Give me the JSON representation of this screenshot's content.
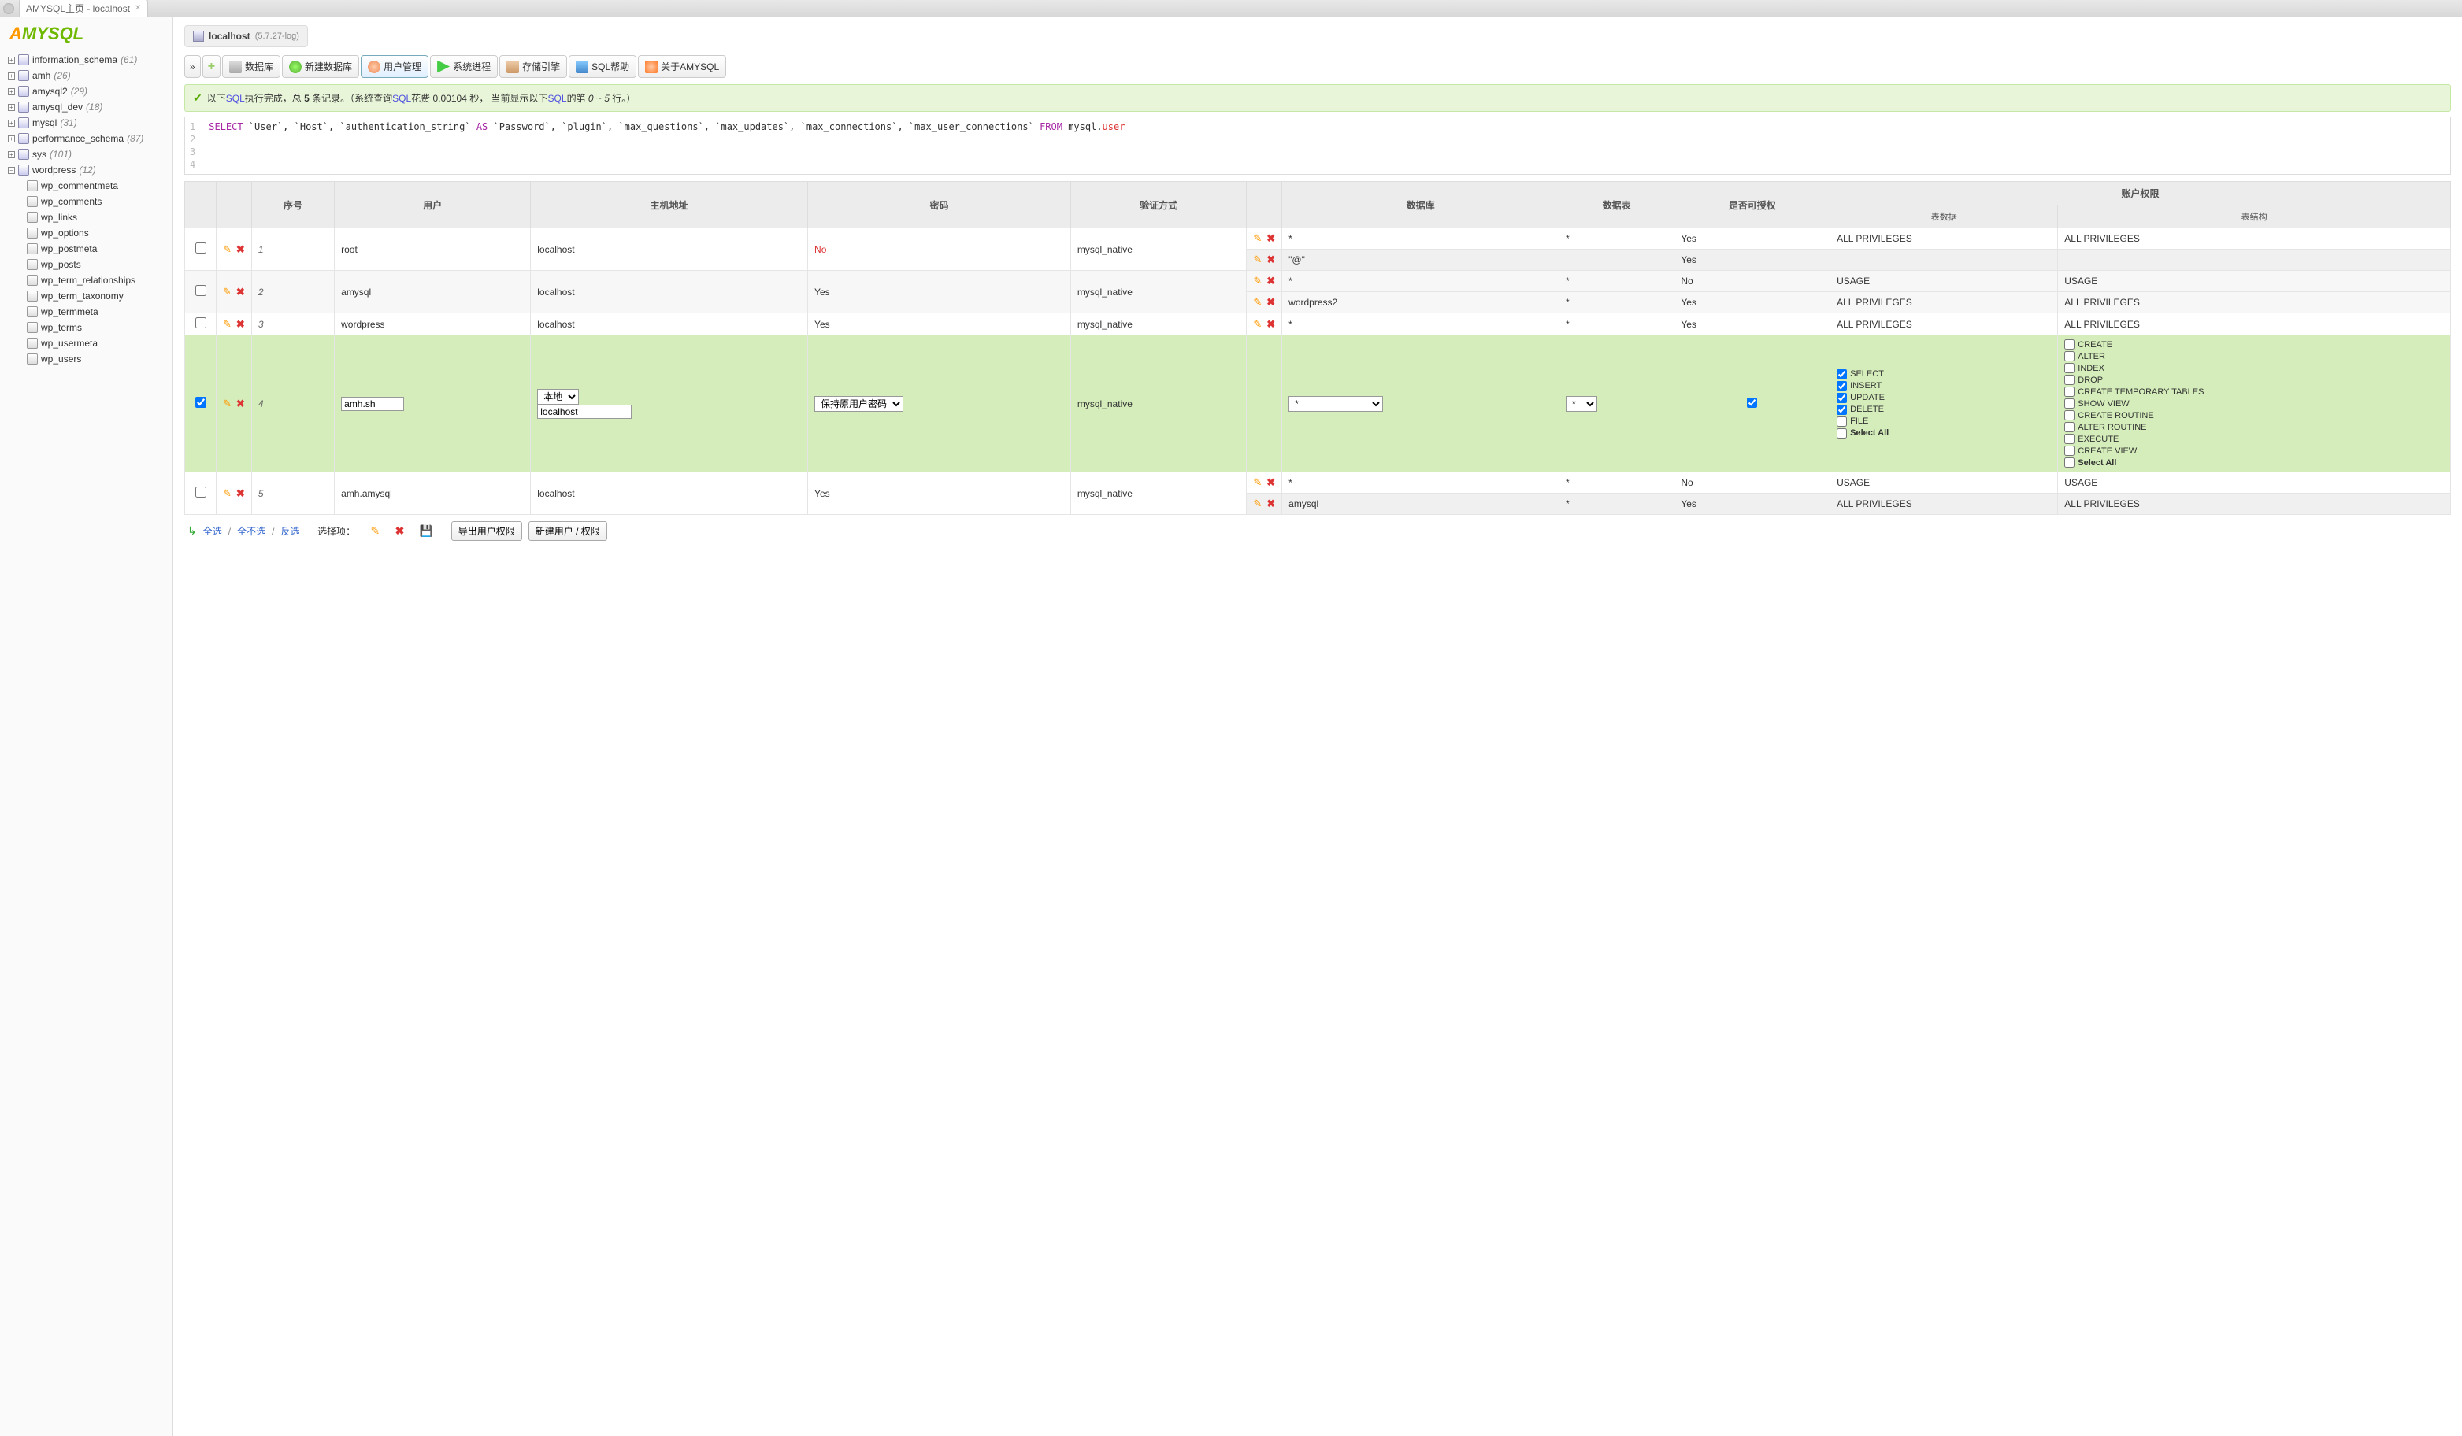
{
  "app": {
    "tab_title": "AMYSQL主页 - localhost"
  },
  "logo": {
    "part1": "A",
    "part2": "MY",
    "part3": "SQL"
  },
  "sidebar": {
    "items": [
      {
        "label": "information_schema",
        "count": "(61)",
        "toggle": "+"
      },
      {
        "label": "amh",
        "count": "(26)",
        "toggle": "+"
      },
      {
        "label": "amysql2",
        "count": "(29)",
        "toggle": "+"
      },
      {
        "label": "amysql_dev",
        "count": "(18)",
        "toggle": "+"
      },
      {
        "label": "mysql",
        "count": "(31)",
        "toggle": "+"
      },
      {
        "label": "performance_schema",
        "count": "(87)",
        "toggle": "+"
      },
      {
        "label": "sys",
        "count": "(101)",
        "toggle": "+"
      },
      {
        "label": "wordpress",
        "count": "(12)",
        "toggle": "−"
      }
    ],
    "tables": [
      "wp_commentmeta",
      "wp_comments",
      "wp_links",
      "wp_options",
      "wp_postmeta",
      "wp_posts",
      "wp_term_relationships",
      "wp_term_taxonomy",
      "wp_termmeta",
      "wp_terms",
      "wp_usermeta",
      "wp_users"
    ]
  },
  "breadcrumb": {
    "host": "localhost",
    "version": "(5.7.27-log)"
  },
  "toolbar": {
    "nav": "»",
    "items": [
      {
        "label": "数据库"
      },
      {
        "label": "新建数据库"
      },
      {
        "label": "用户管理"
      },
      {
        "label": "系统进程"
      },
      {
        "label": "存储引擎"
      },
      {
        "label": "SQL帮助"
      },
      {
        "label": "关于AMYSQL"
      }
    ]
  },
  "status": {
    "prefix": "以下",
    "sql1": "SQL",
    "mid1": "执行完成，总 ",
    "count": "5",
    "mid2": " 条记录。（系统查询",
    "sql2": "SQL",
    "mid3": "花费 0.00104 秒，  当前显示以下",
    "sql3": "SQL",
    "mid4": "的第 ",
    "range": "0 ~ 5",
    "mid5": " 行。）"
  },
  "sql_display": {
    "line1_parts": {
      "p1": "SELECT",
      "p2": " `User`, `Host`, `authentication_string` ",
      "p3": "AS",
      "p4": " `Password`, `plugin`, `max_questions`, `max_updates`, `max_connections`, `max_user_connections` ",
      "p5": "FROM",
      "p6": " mysql.",
      "p7": "user"
    },
    "gutter": [
      "1",
      "2",
      "3",
      "4"
    ]
  },
  "table": {
    "headers": {
      "seq": "序号",
      "user": "用户",
      "host": "主机地址",
      "password": "密码",
      "auth": "验证方式",
      "db": "数据库",
      "tables": "数据表",
      "grant": "是否可授权",
      "priv": "账户权限",
      "priv_data": "表数据",
      "priv_struct": "表结构"
    },
    "rows": [
      {
        "seq": "1",
        "user": "root",
        "host": "localhost",
        "pw": "No",
        "pw_class": "no-text",
        "auth": "mysql_native",
        "subs": [
          {
            "db": "*",
            "tbl": "*",
            "grant": "Yes",
            "pd": "ALL PRIVILEGES",
            "ps": "ALL PRIVILEGES"
          },
          {
            "db": "\"@\"",
            "tbl": "",
            "grant": "Yes",
            "pd": "",
            "ps": ""
          }
        ]
      },
      {
        "seq": "2",
        "user": "amysql",
        "host": "localhost",
        "pw": "Yes",
        "auth": "mysql_native",
        "subs": [
          {
            "db": "*",
            "tbl": "*",
            "grant": "No",
            "pd": "USAGE",
            "ps": "USAGE"
          },
          {
            "db": "wordpress2",
            "tbl": "*",
            "grant": "Yes",
            "pd": "ALL PRIVILEGES",
            "ps": "ALL PRIVILEGES"
          }
        ]
      },
      {
        "seq": "3",
        "user": "wordpress",
        "host": "localhost",
        "pw": "Yes",
        "auth": "mysql_native",
        "subs": [
          {
            "db": "*",
            "tbl": "*",
            "grant": "Yes",
            "pd": "ALL PRIVILEGES",
            "ps": "ALL PRIVILEGES"
          }
        ]
      },
      {
        "seq": "5",
        "user": "amh.amysql",
        "host": "localhost",
        "pw": "Yes",
        "auth": "mysql_native",
        "subs": [
          {
            "db": "*",
            "tbl": "*",
            "grant": "No",
            "pd": "USAGE",
            "ps": "USAGE"
          },
          {
            "db": "amysql",
            "tbl": "*",
            "grant": "Yes",
            "pd": "ALL PRIVILEGES",
            "ps": "ALL PRIVILEGES"
          }
        ]
      }
    ],
    "edit_row": {
      "seq": "4",
      "user_value": "amh.sh",
      "host_type": "本地",
      "host_value": "localhost",
      "pw_option": "保持原用户密码",
      "auth": "mysql_native",
      "db": "*",
      "tbl": "*",
      "priv_data": [
        {
          "label": "SELECT",
          "checked": true
        },
        {
          "label": "INSERT",
          "checked": true
        },
        {
          "label": "UPDATE",
          "checked": true
        },
        {
          "label": "DELETE",
          "checked": true
        },
        {
          "label": "FILE",
          "checked": false
        },
        {
          "label": "Select All",
          "checked": false,
          "bold": true
        }
      ],
      "priv_struct": [
        {
          "label": "CREATE",
          "checked": false
        },
        {
          "label": "ALTER",
          "checked": false
        },
        {
          "label": "INDEX",
          "checked": false
        },
        {
          "label": "DROP",
          "checked": false
        },
        {
          "label": "CREATE TEMPORARY TABLES",
          "checked": false
        },
        {
          "label": "SHOW VIEW",
          "checked": false
        },
        {
          "label": "CREATE ROUTINE",
          "checked": false
        },
        {
          "label": "ALTER ROUTINE",
          "checked": false
        },
        {
          "label": "EXECUTE",
          "checked": false
        },
        {
          "label": "CREATE VIEW",
          "checked": false
        },
        {
          "label": "Select All",
          "checked": false,
          "bold": true
        }
      ]
    }
  },
  "footer": {
    "select_all": "全选",
    "select_none": "全不选",
    "invert": "反选",
    "label": "选择项：",
    "export": "导出用户权限",
    "new_user": "新建用户 / 权限"
  }
}
